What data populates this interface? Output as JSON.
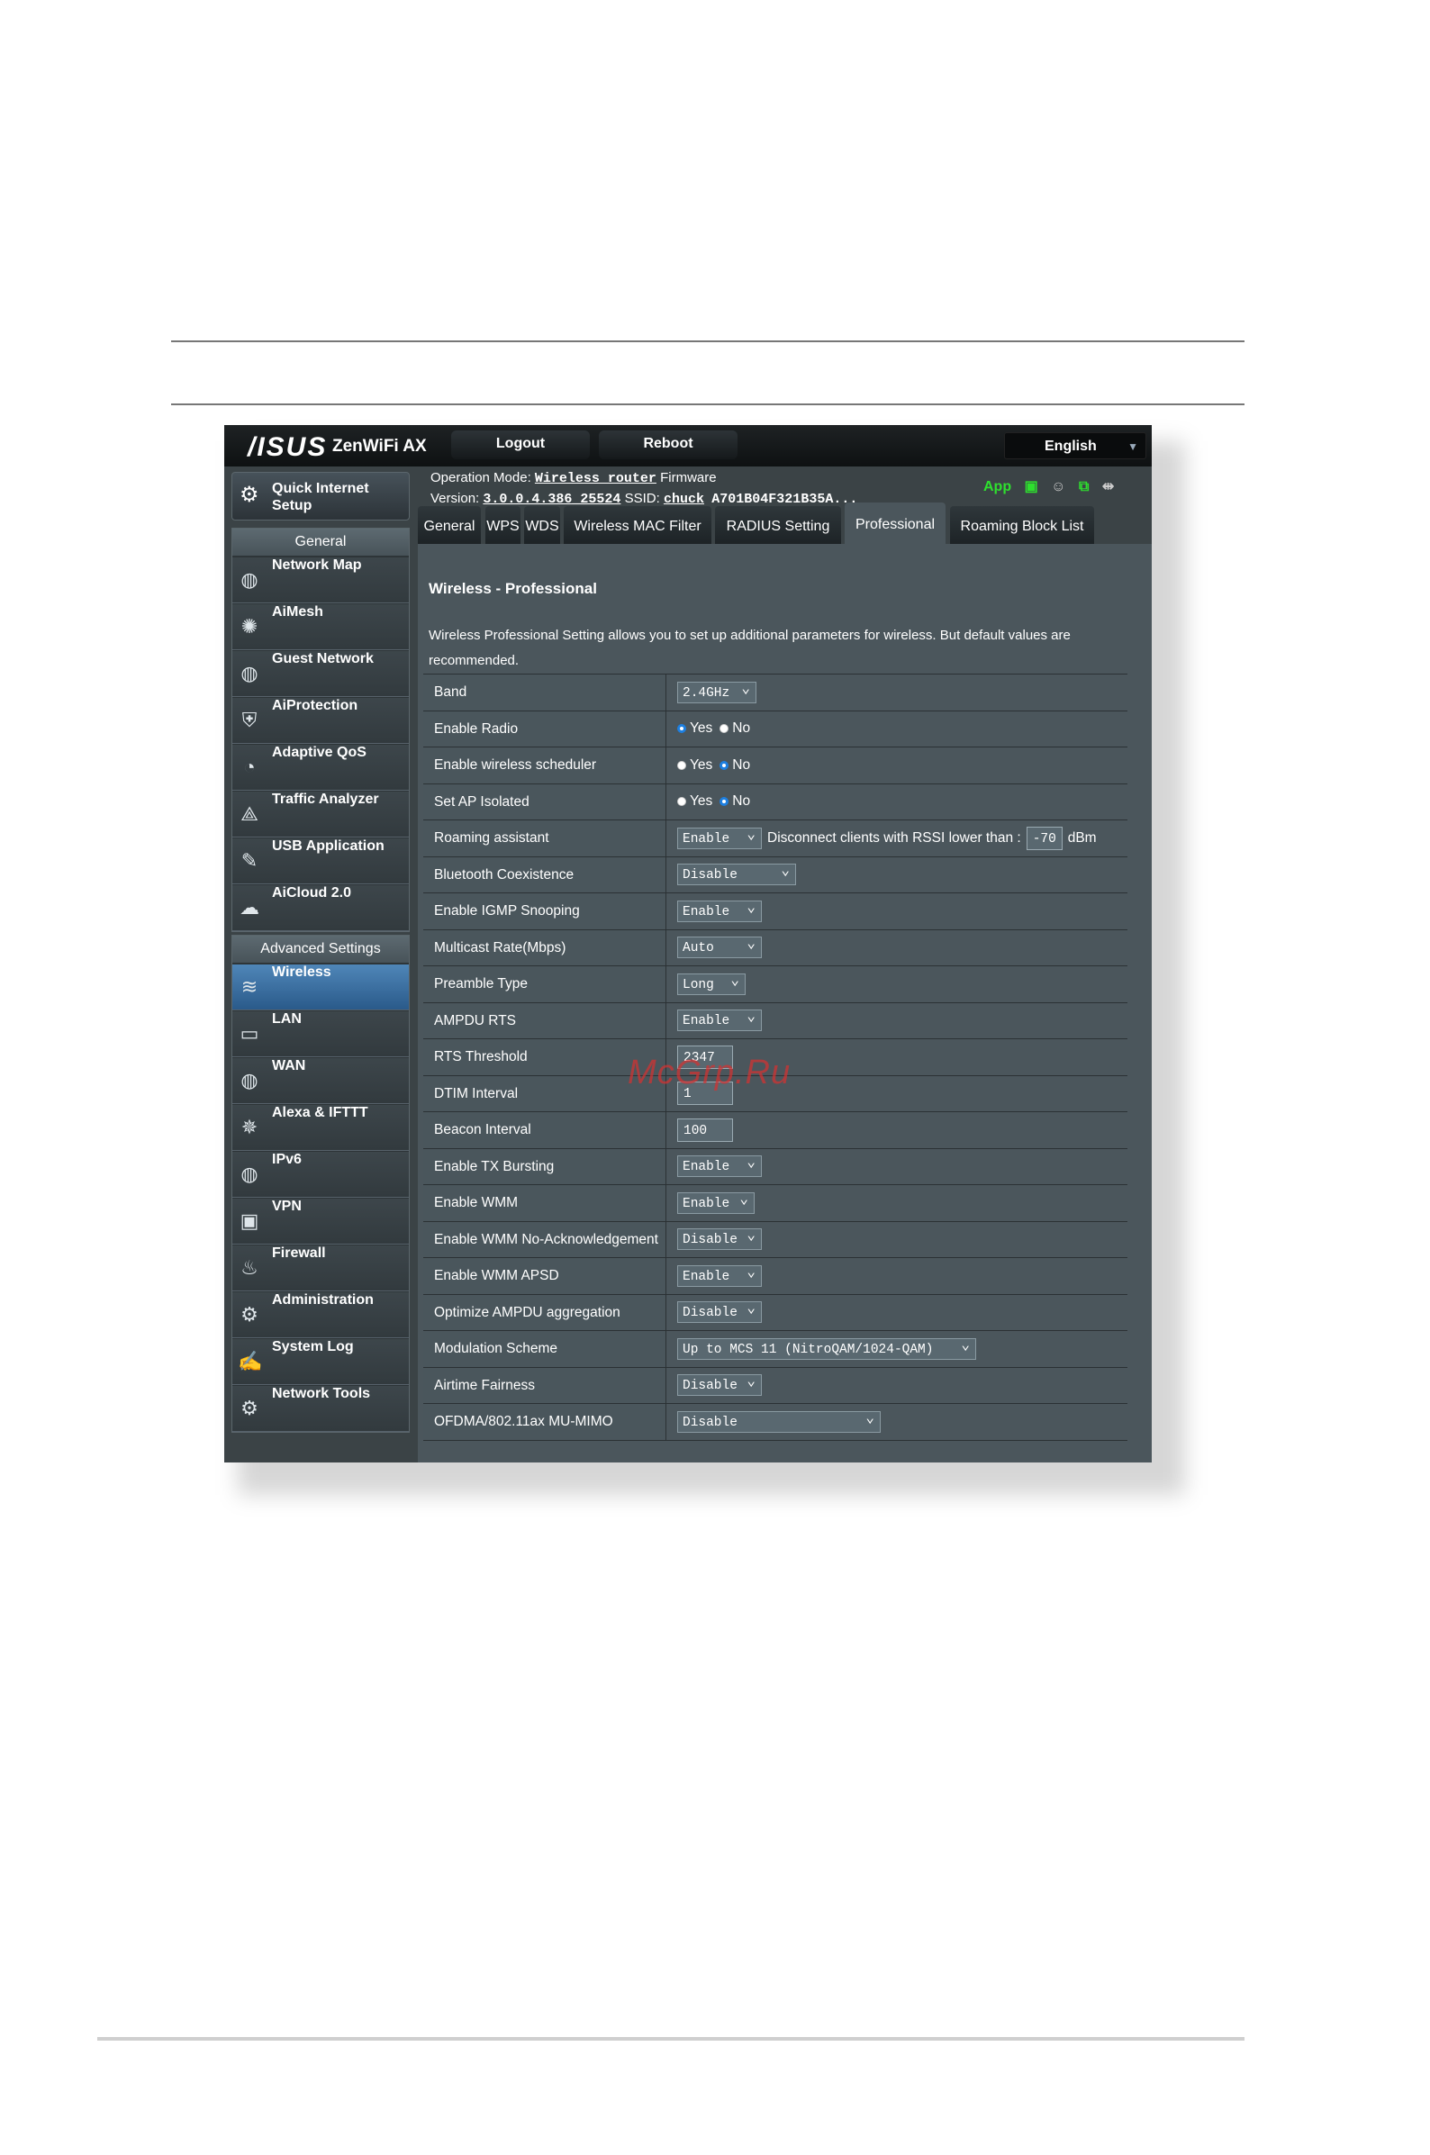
{
  "topbar": {
    "logo": "/ISUS",
    "model": "ZenWiFi AX",
    "logout": "Logout",
    "reboot": "Reboot",
    "language": "English"
  },
  "info": {
    "op_mode_label": "Operation Mode:",
    "op_mode_value": "Wireless router",
    "firmware_label": "Firmware",
    "version_label": "Version:",
    "version_value": "3.0.0.4.386_25524",
    "ssid_label": "SSID:",
    "ssid_value": "chuck",
    "ssid_extra": "A701B04F321B35A...",
    "app_label": "App"
  },
  "sidebar": {
    "qis_label": "Quick Internet Setup",
    "general_title": "General",
    "general_items": [
      {
        "label": "Network Map",
        "icon": "globe-icon"
      },
      {
        "label": "AiMesh",
        "icon": "mesh-icon"
      },
      {
        "label": "Guest Network",
        "icon": "guest-globe-icon"
      },
      {
        "label": "AiProtection",
        "icon": "lock-shield-icon"
      },
      {
        "label": "Adaptive QoS",
        "icon": "gauge-icon"
      },
      {
        "label": "Traffic Analyzer",
        "icon": "chart-icon"
      },
      {
        "label": "USB Application",
        "icon": "usb-icon"
      },
      {
        "label": "AiCloud 2.0",
        "icon": "cloud-icon"
      }
    ],
    "advanced_title": "Advanced Settings",
    "advanced_items": [
      {
        "label": "Wireless",
        "icon": "wifi-icon",
        "active": true
      },
      {
        "label": "LAN",
        "icon": "monitor-icon"
      },
      {
        "label": "WAN",
        "icon": "globe-icon"
      },
      {
        "label": "Alexa & IFTTT",
        "icon": "alexa-icon"
      },
      {
        "label": "IPv6",
        "icon": "ipv6-globe-icon"
      },
      {
        "label": "VPN",
        "icon": "vpn-icon"
      },
      {
        "label": "Firewall",
        "icon": "fire-icon"
      },
      {
        "label": "Administration",
        "icon": "admin-gear-icon"
      },
      {
        "label": "System Log",
        "icon": "log-icon"
      },
      {
        "label": "Network Tools",
        "icon": "tools-gear-icon"
      }
    ]
  },
  "tabs": [
    "General",
    "WPS",
    "WDS",
    "Wireless MAC Filter",
    "RADIUS Setting",
    "Professional",
    "Roaming Block List"
  ],
  "active_tab": "Professional",
  "panel": {
    "title": "Wireless - Professional",
    "description": "Wireless Professional Setting allows you to set up additional parameters for wireless. But default values are recommended."
  },
  "settings": [
    {
      "label": "Band",
      "select": "2.4GHz"
    },
    {
      "label": "Enable Radio",
      "radio": "Yes"
    },
    {
      "label": "Enable wireless scheduler",
      "radio": "No"
    },
    {
      "label": "Set AP Isolated",
      "radio": "No"
    },
    {
      "label": "Roaming assistant",
      "select": "Enable",
      "extra_text": "Disconnect clients with RSSI lower than :",
      "input": "-70",
      "unit": "dBm"
    },
    {
      "label": "Bluetooth Coexistence",
      "select": "Disable"
    },
    {
      "label": "Enable IGMP Snooping",
      "select": "Enable"
    },
    {
      "label": "Multicast Rate(Mbps)",
      "select": "Auto"
    },
    {
      "label": "Preamble Type",
      "select": "Long"
    },
    {
      "label": "AMPDU RTS",
      "select": "Enable"
    },
    {
      "label": "RTS Threshold",
      "input": "2347"
    },
    {
      "label": "DTIM Interval",
      "input": "1"
    },
    {
      "label": "Beacon Interval",
      "input": "100"
    },
    {
      "label": "Enable TX Bursting",
      "select": "Enable"
    },
    {
      "label": "Enable WMM",
      "select": "Enable"
    },
    {
      "label": "Enable WMM No-Acknowledgement",
      "select": "Disable"
    },
    {
      "label": "Enable WMM APSD",
      "select": "Enable"
    },
    {
      "label": "Optimize AMPDU aggregation",
      "select": "Disable"
    },
    {
      "label": "Modulation Scheme",
      "select": "Up to MCS 11 (NitroQAM/1024-QAM)"
    },
    {
      "label": "Airtime Fairness",
      "select": "Disable"
    },
    {
      "label": "OFDMA/802.11ax MU-MIMO",
      "select": "Disable"
    }
  ],
  "radio_labels": {
    "yes": "Yes",
    "no": "No"
  },
  "watermark": "McGrp.Ru",
  "colors": {
    "active_nav": "#3a6fa0",
    "radio_on": "#1d7fe0",
    "status_green": "#2ee02e"
  }
}
